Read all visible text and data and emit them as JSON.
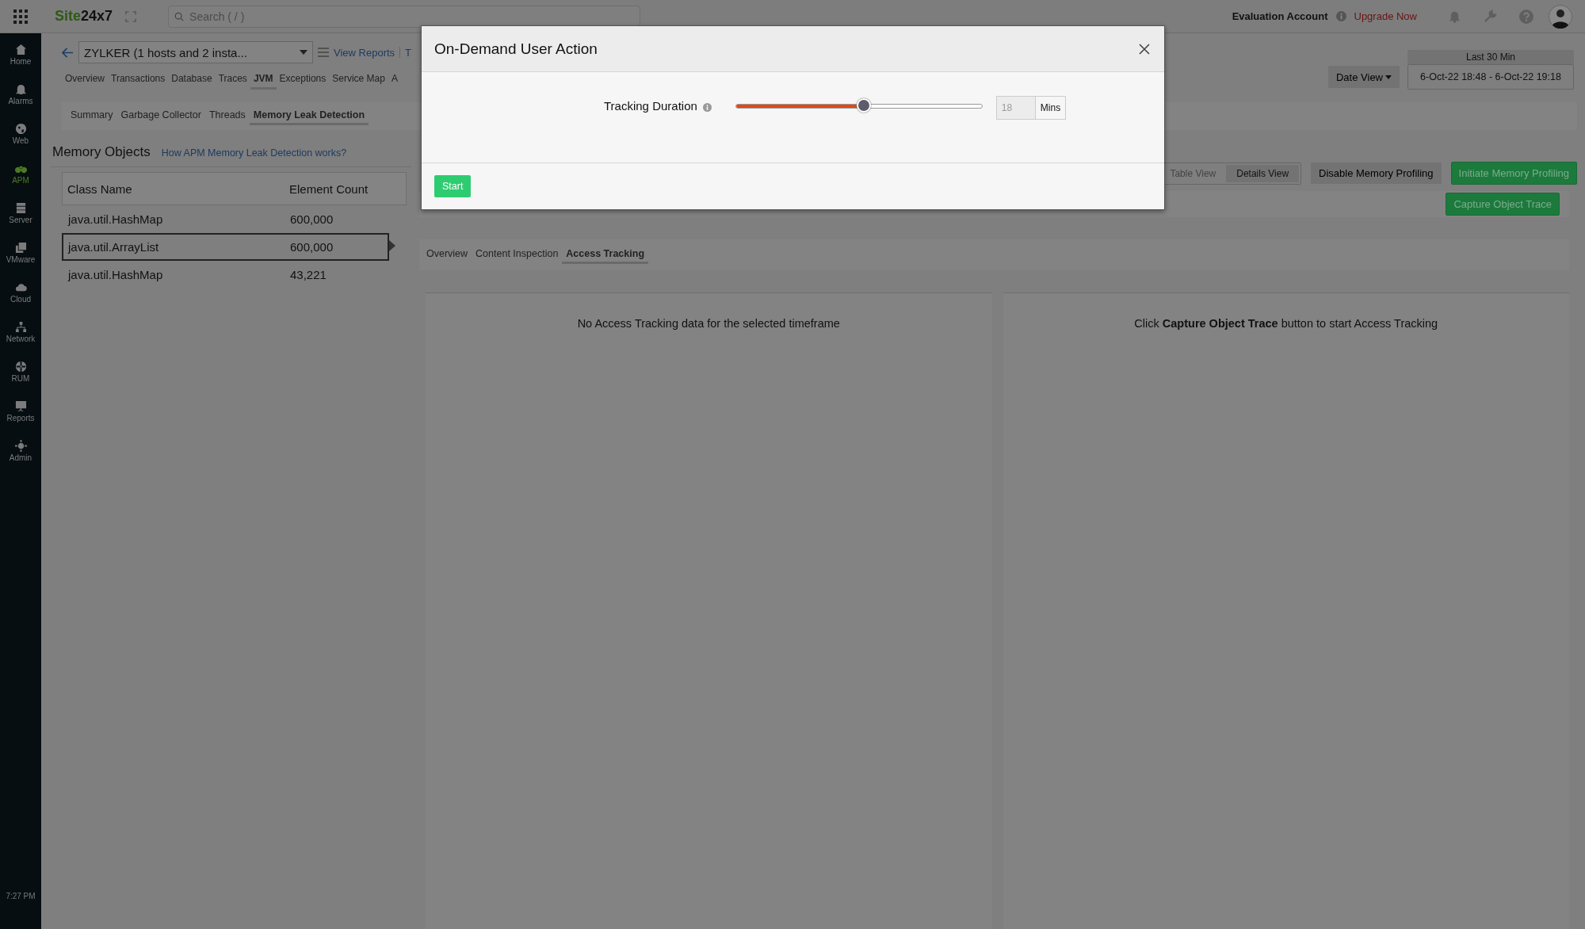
{
  "topbar": {
    "logo_a": "Site",
    "logo_b": "24x7",
    "search": {
      "placeholder": "Search ( / )"
    },
    "account": "Evaluation Account",
    "upgrade": "Upgrade Now"
  },
  "sidebar": {
    "items": [
      {
        "label": "Home",
        "selected": false
      },
      {
        "label": "Alarms",
        "selected": false
      },
      {
        "label": "Web",
        "selected": false
      },
      {
        "label": "APM",
        "selected": true
      },
      {
        "label": "Server",
        "selected": false
      },
      {
        "label": "VMware",
        "selected": false
      },
      {
        "label": "Cloud",
        "selected": false
      },
      {
        "label": "Network",
        "selected": false
      },
      {
        "label": "RUM",
        "selected": false
      },
      {
        "label": "Reports",
        "selected": false
      },
      {
        "label": "Admin",
        "selected": false
      }
    ],
    "time": "7:27 PM"
  },
  "monitor": {
    "name": "ZYLKER (1 hosts and 2 insta...",
    "view_reports": "View Reports",
    "cut_link": "T"
  },
  "tabs": [
    {
      "label": "Overview",
      "selected": false
    },
    {
      "label": "Transactions",
      "selected": false
    },
    {
      "label": "Database",
      "selected": false
    },
    {
      "label": "Traces",
      "selected": false
    },
    {
      "label": "JVM",
      "selected": true
    },
    {
      "label": "Exceptions",
      "selected": false
    },
    {
      "label": "Service Map",
      "selected": false
    },
    {
      "label": "A",
      "selected": false
    }
  ],
  "subtabs": [
    {
      "label": "Summary",
      "selected": false
    },
    {
      "label": "Garbage Collector",
      "selected": false
    },
    {
      "label": "Threads",
      "selected": false
    },
    {
      "label": "Memory Leak Detection",
      "selected": true
    }
  ],
  "date": {
    "button": "Date View",
    "period": "Last 30 Min",
    "range": "6-Oct-22 18:48 - 6-Oct-22 19:18"
  },
  "memory_objects": {
    "title": "Memory Objects",
    "help_link": "How APM Memory Leak Detection works?",
    "columns": [
      "Class Name",
      "Element Count"
    ],
    "rows": [
      {
        "class_name": "java.util.HashMap",
        "element_count": "600,000",
        "selected": false
      },
      {
        "class_name": "java.util.ArrayList",
        "element_count": "600,000",
        "selected": true
      },
      {
        "class_name": "java.util.HashMap",
        "element_count": "43,221",
        "selected": false
      }
    ]
  },
  "view_toggle": [
    {
      "label": "Table View",
      "selected": false
    },
    {
      "label": "Details View",
      "selected": true
    }
  ],
  "actions": {
    "disable": "Disable Memory Profiling",
    "initiate": "Initiate Memory Profiling",
    "capture": "Capture Object Trace"
  },
  "detail_tabs": [
    {
      "label": "Overview",
      "selected": false
    },
    {
      "label": "Content Inspection",
      "selected": false
    },
    {
      "label": "Access Tracking",
      "selected": true
    }
  ],
  "panels": [
    "No Access Tracking data for the selected timeframe",
    "Click **Capture Object Trace** button to start Access Tracking"
  ],
  "dialog": {
    "title": "On-Demand User Action",
    "field_label": "Tracking Duration",
    "level": 0.52,
    "value": "18",
    "unit": "Mins",
    "button": "Start"
  }
}
